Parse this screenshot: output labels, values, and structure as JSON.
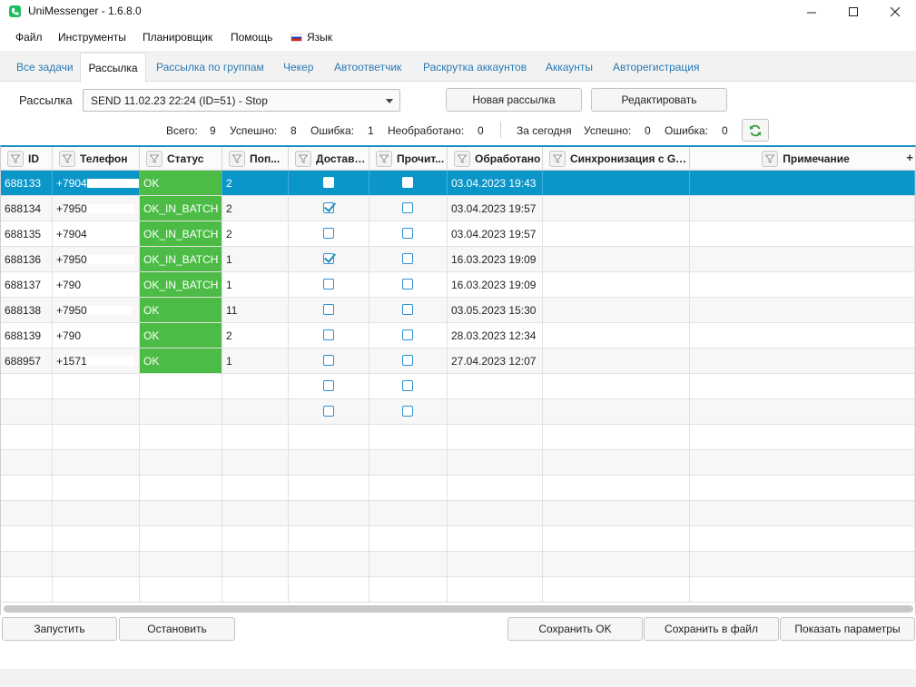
{
  "window": {
    "title": "UniMessenger - 1.6.8.0"
  },
  "menu": [
    "Файл",
    "Инструменты",
    "Планировщик",
    "Помощь",
    "Язык"
  ],
  "tabs": [
    "Все задачи",
    "Рассылка",
    "Рассылка по группам",
    "Чекер",
    "Автоответчик",
    "Раскрутка аккаунтов",
    "Аккаунты",
    "Авторегистрация"
  ],
  "active_tab": "Рассылка",
  "mailing": {
    "label": "Рассылка",
    "selected": "SEND 11.02.23 22:24 (ID=51) - Stop",
    "new_button": "Новая рассылка",
    "edit_button": "Редактировать"
  },
  "stats": {
    "total_label": "Всего:",
    "total": "9",
    "success_label": "Успешно:",
    "success": "8",
    "error_label": "Ошибка:",
    "error": "1",
    "unprocessed_label": "Необработано:",
    "unprocessed": "0",
    "today_label": "За сегодня",
    "today_success_label": "Успешно:",
    "today_success": "0",
    "today_error_label": "Ошибка:",
    "today_error": "0"
  },
  "columns": [
    "ID",
    "Телефон",
    "Статус",
    "Поп...",
    "Доставл...",
    "Прочит...",
    "Обработано",
    "Синхронизация с Go...",
    "Примечание"
  ],
  "rows": [
    {
      "id": "688133",
      "phone": "+7904",
      "status": "OK",
      "attempts": "2",
      "delivered": false,
      "read": false,
      "processed": "03.04.2023 19:43",
      "selected": true
    },
    {
      "id": "688134",
      "phone": "+7950",
      "status": "OK_IN_BATCH",
      "attempts": "2",
      "delivered": true,
      "read": false,
      "processed": "03.04.2023 19:57"
    },
    {
      "id": "688135",
      "phone": "+7904",
      "status": "OK_IN_BATCH",
      "attempts": "2",
      "delivered": false,
      "read": false,
      "processed": "03.04.2023 19:57"
    },
    {
      "id": "688136",
      "phone": "+7950",
      "status": "OK_IN_BATCH",
      "attempts": "1",
      "delivered": true,
      "read": false,
      "processed": "16.03.2023 19:09"
    },
    {
      "id": "688137",
      "phone": "+790",
      "status": "OK_IN_BATCH",
      "attempts": "1",
      "delivered": false,
      "read": false,
      "processed": "16.03.2023 19:09"
    },
    {
      "id": "688138",
      "phone": "+7950",
      "status": "OK",
      "attempts": "11",
      "delivered": false,
      "read": false,
      "processed": "03.05.2023 15:30"
    },
    {
      "id": "688139",
      "phone": "+790",
      "status": "OK",
      "attempts": "2",
      "delivered": false,
      "read": false,
      "processed": "28.03.2023 12:34"
    },
    {
      "id": "688957",
      "phone": "+1571",
      "status": "OK",
      "attempts": "1",
      "delivered": false,
      "read": false,
      "processed": "27.04.2023 12:07"
    },
    {
      "id": "",
      "phone": "",
      "status": "",
      "attempts": "",
      "delivered": false,
      "read": false,
      "processed": ""
    },
    {
      "id": "",
      "phone": "",
      "status": "",
      "attempts": "",
      "delivered": false,
      "read": false,
      "processed": ""
    }
  ],
  "bottom_buttons": {
    "start": "Запустить",
    "stop": "Остановить",
    "save_ok": "Сохранить OK",
    "save_file": "Сохранить в файл",
    "show_params": "Показать параметры"
  },
  "colors": {
    "accent": "#1a8fc4",
    "selected_row": "#0a96c8",
    "status_ok": "#4cbc46",
    "app_icon": "#1fbf5f"
  }
}
